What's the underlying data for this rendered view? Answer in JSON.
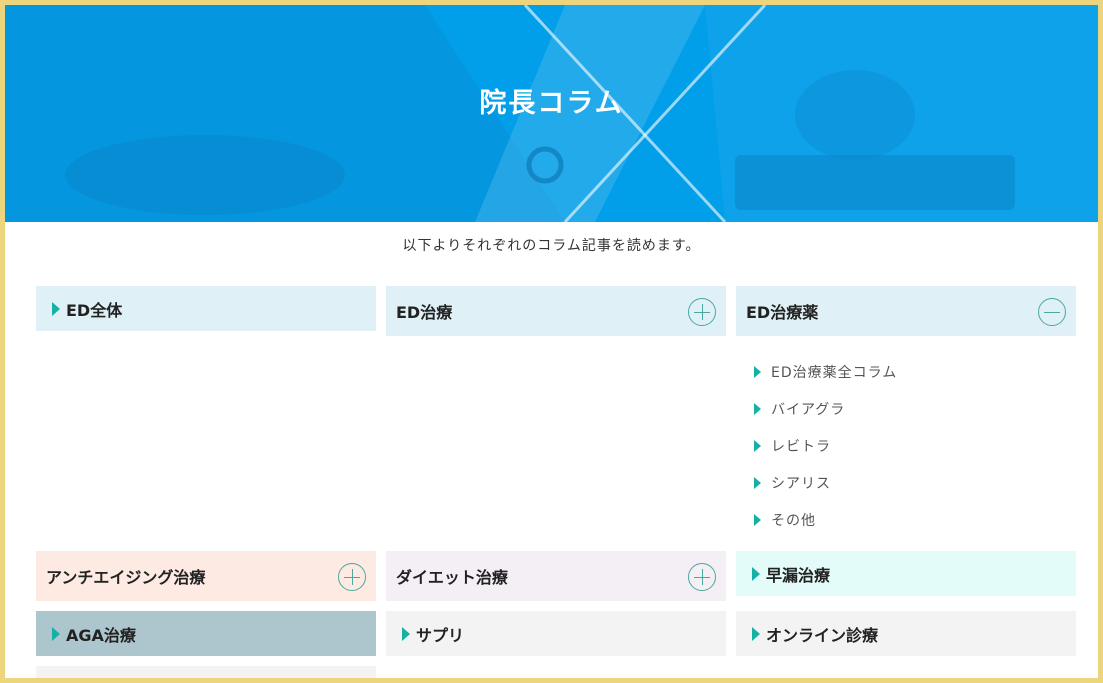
{
  "hero": {
    "title": "院長コラム"
  },
  "intro": "以下よりそれぞれのコラム記事を読めます。",
  "categories": [
    {
      "label": "ED全体",
      "type": "link"
    },
    {
      "label": "ED治療",
      "type": "expand"
    },
    {
      "label": "ED治療薬",
      "type": "collapse"
    },
    {
      "label": "アンチエイジング治療",
      "type": "expand"
    },
    {
      "label": "ダイエット治療",
      "type": "expand"
    },
    {
      "label": "早漏治療",
      "type": "link"
    },
    {
      "label": "AGA治療",
      "type": "link"
    },
    {
      "label": "サプリ",
      "type": "link"
    },
    {
      "label": "オンライン診療",
      "type": "link"
    }
  ],
  "ed_drug_sublinks": [
    "ED治療薬全コラム",
    "バイアグラ",
    "レビトラ",
    "シアリス",
    "その他"
  ],
  "colors": {
    "hero": "#019ee9",
    "frame": "#ecd57c",
    "accent": "#17b0a4",
    "blue_card": "#dff0f7",
    "peach_card": "#fdeae2",
    "lavender_card": "#f4eef5",
    "mint_card": "#e3fcfa",
    "slate_card": "#adc5cd",
    "gray_card": "#f4f3f4"
  }
}
